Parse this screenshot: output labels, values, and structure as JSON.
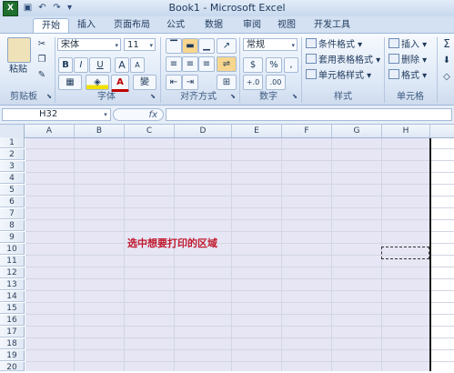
{
  "window": {
    "title": "Book1 - Microsoft Excel",
    "app_icon_letter": "X"
  },
  "tabs": [
    "开始",
    "插入",
    "页面布局",
    "公式",
    "数据",
    "审阅",
    "视图",
    "开发工具"
  ],
  "ribbon": {
    "clipboard": {
      "label": "剪贴板",
      "paste_label": "粘贴"
    },
    "font": {
      "label": "字体",
      "font_name": "宋体",
      "font_size": "11",
      "bold": "B",
      "italic": "I",
      "underline": "U",
      "grow": "A",
      "shrink": "A",
      "font_color": "A"
    },
    "alignment": {
      "label": "对齐方式"
    },
    "number": {
      "label": "数字",
      "format": "常规",
      "currency": "$",
      "percent": "%",
      "comma": ","
    },
    "styles": {
      "label": "样式",
      "conditional": "条件格式",
      "table": "套用表格格式",
      "cell_styles": "单元格样式"
    },
    "cells": {
      "label": "单元格",
      "insert": "插入",
      "delete": "删除",
      "format": "格式"
    },
    "editing": {
      "sum": "Σ"
    }
  },
  "formula_bar": {
    "name_box": "H32",
    "fx": "fx",
    "content": ""
  },
  "sheet": {
    "columns": [
      "A",
      "B",
      "C",
      "D",
      "E",
      "F",
      "G",
      "H"
    ],
    "rows": [
      "1",
      "2",
      "3",
      "4",
      "5",
      "6",
      "7",
      "8",
      "9",
      "10",
      "11",
      "12",
      "13",
      "14",
      "15",
      "16",
      "17",
      "18",
      "19",
      "20"
    ],
    "note": "选中想要打印的区域"
  }
}
